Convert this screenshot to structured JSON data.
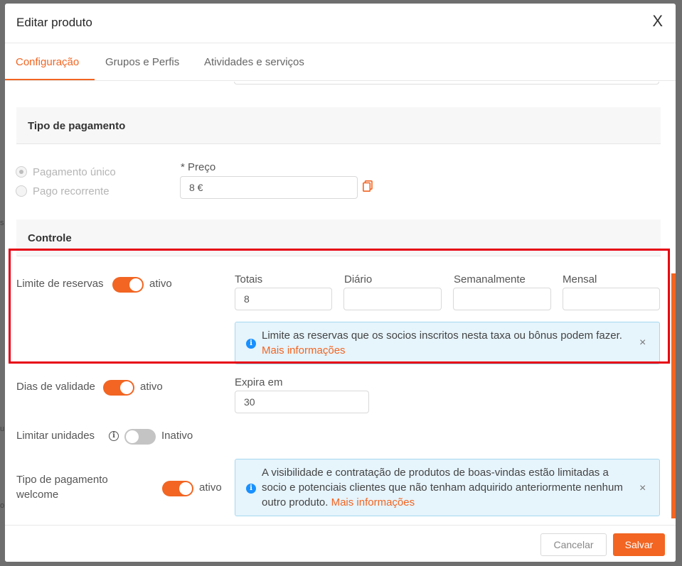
{
  "modal": {
    "title": "Editar produto",
    "close_label": "X"
  },
  "tabs": [
    {
      "label": "Configuração",
      "active": true
    },
    {
      "label": "Grupos e Perfis",
      "active": false
    },
    {
      "label": "Atividades e serviços",
      "active": false
    }
  ],
  "payment": {
    "section_title": "Tipo de pagamento",
    "options": [
      {
        "label": "Pagamento único",
        "selected": true
      },
      {
        "label": "Pago recorrente",
        "selected": false
      }
    ],
    "price_label": "* Preço",
    "price_value": "8 €"
  },
  "control": {
    "section_title": "Controle",
    "booking_limit": {
      "label": "Limite de reservas",
      "state": "ativo",
      "on": true,
      "fields": [
        {
          "label": "Totais",
          "value": "8"
        },
        {
          "label": "Diário",
          "value": ""
        },
        {
          "label": "Semanalmente",
          "value": ""
        },
        {
          "label": "Mensal",
          "value": ""
        }
      ],
      "info_text": "Limite as reservas que os socios inscritos nesta taxa ou bônus podem fazer.",
      "info_link": "Mais informações"
    },
    "validity": {
      "label": "Dias de validade",
      "state": "ativo",
      "on": true,
      "field_label": "Expira em",
      "field_value": "30"
    },
    "unit_limit": {
      "label": "Limitar unidades",
      "state": "Inativo",
      "on": false
    },
    "welcome": {
      "label_line1": "Tipo de pagamento",
      "label_line2": "welcome",
      "state": "ativo",
      "on": true,
      "info_text": "A visibilidade e contratação de produtos de boas-vindas estão limitadas a socio e potenciais clientes que não tenham adquirido anteriormente nenhum outro produto.",
      "info_link": "Mais informações"
    }
  },
  "footer": {
    "cancel_label": "Cancelar",
    "save_label": "Salvar"
  },
  "colors": {
    "accent": "#f26522",
    "info_bg": "#e6f4fb",
    "highlight": "#e60012"
  }
}
